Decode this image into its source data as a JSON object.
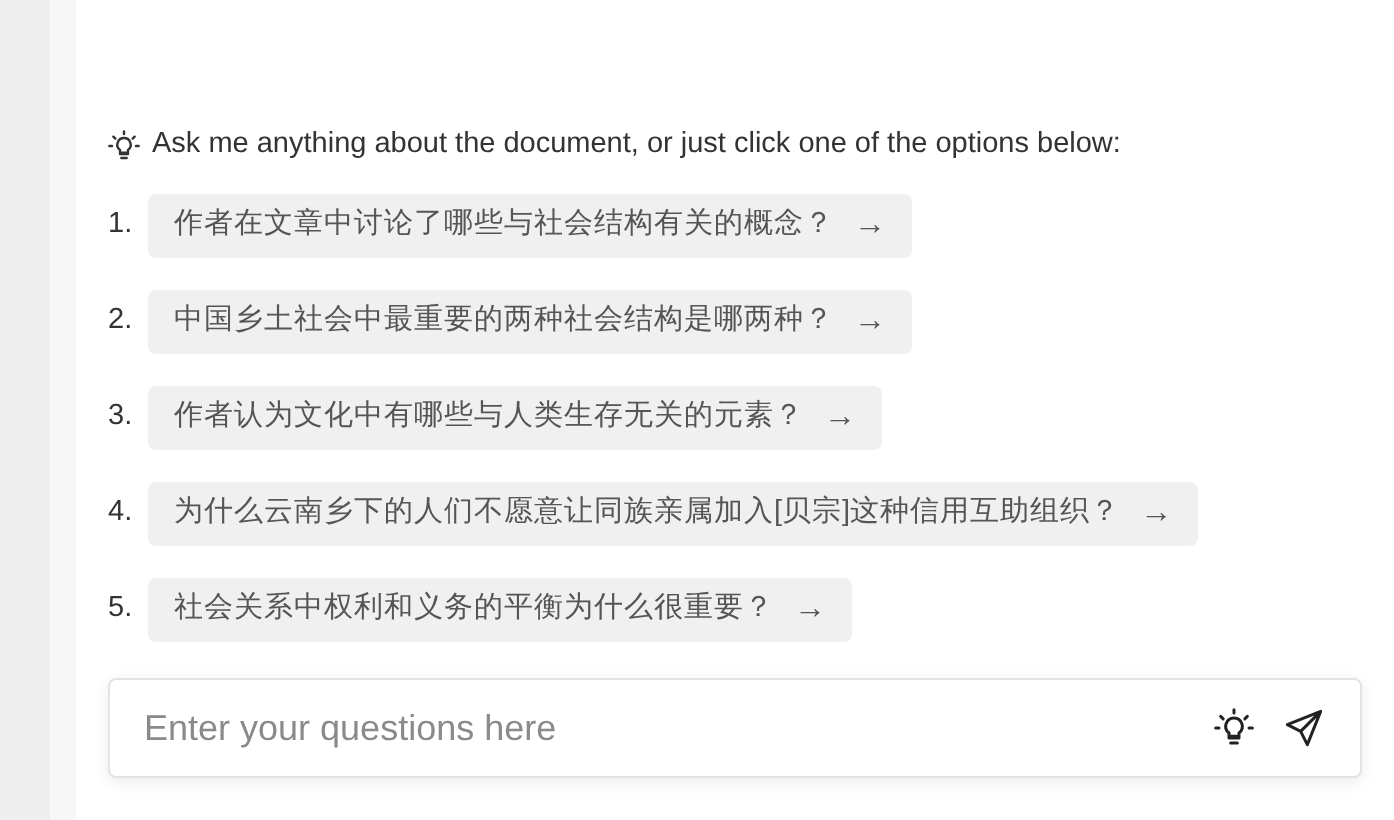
{
  "hint": "Ask me anything about the document, or just click one of the options below:",
  "suggestions": [
    {
      "number": "1.",
      "text": "作者在文章中讨论了哪些与社会结构有关的概念？",
      "arrow": "→"
    },
    {
      "number": "2.",
      "text": "中国乡土社会中最重要的两种社会结构是哪两种？",
      "arrow": "→"
    },
    {
      "number": "3.",
      "text": "作者认为文化中有哪些与人类生存无关的元素？",
      "arrow": "→"
    },
    {
      "number": "4.",
      "text": "为什么云南乡下的人们不愿意让同族亲属加入[贝宗]这种信用互助组织？",
      "arrow": "→"
    },
    {
      "number": "5.",
      "text": "社会关系中权利和义务的平衡为什么很重要？",
      "arrow": "→"
    }
  ],
  "input": {
    "placeholder": "Enter your questions here"
  }
}
